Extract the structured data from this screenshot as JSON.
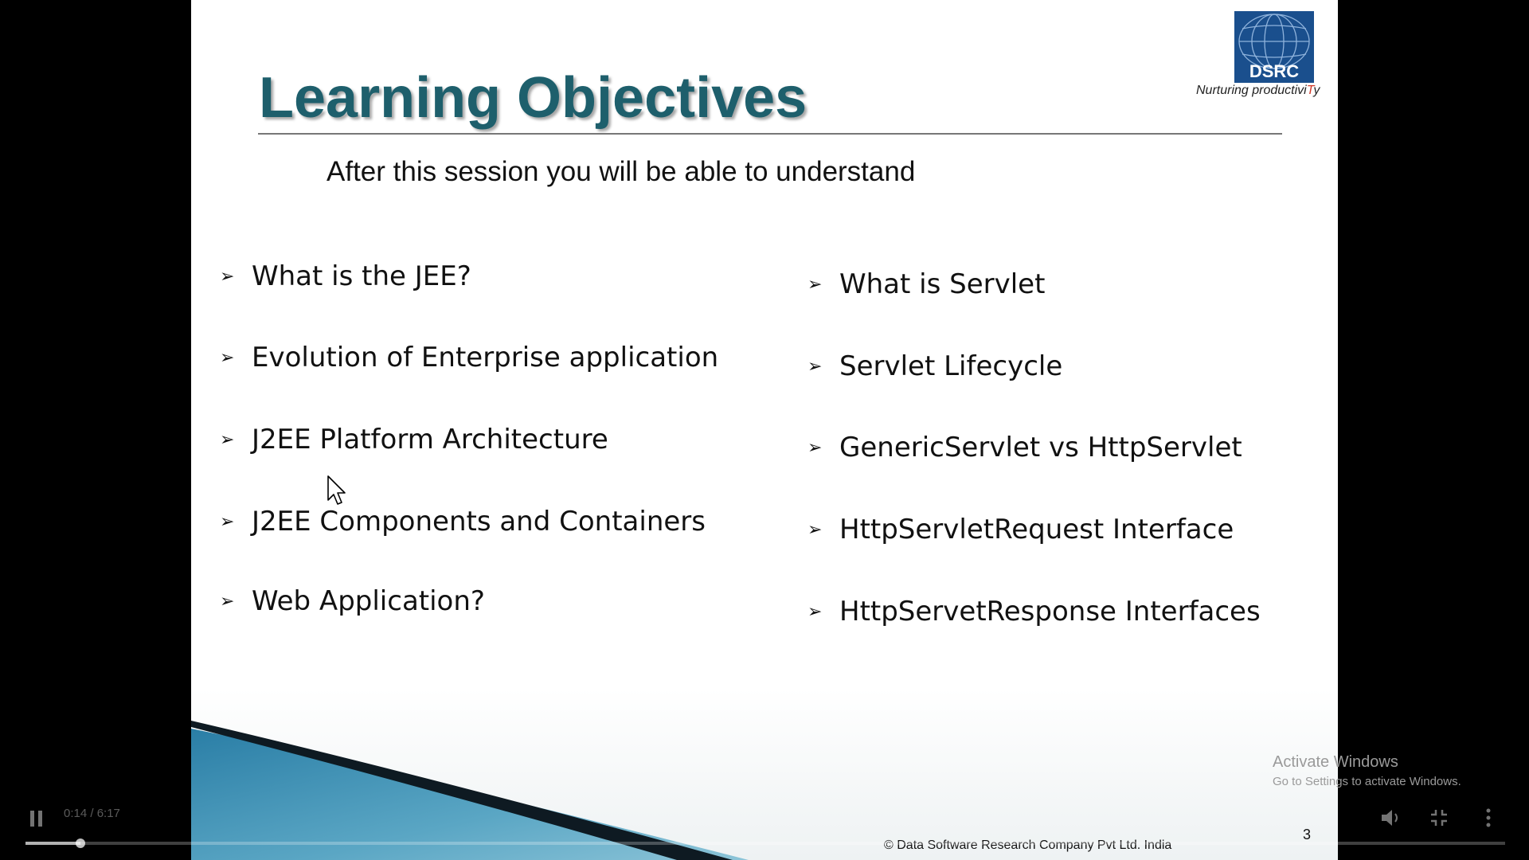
{
  "slide": {
    "title": "Learning Objectives",
    "subtitle": "After this session you will be able to understand",
    "objectives_left": [
      "What is the JEE?",
      "Evolution of Enterprise application",
      "J2EE Platform Architecture",
      "J2EE Components and Containers",
      "Web Application?"
    ],
    "objectives_right": [
      "What is Servlet",
      "Servlet Lifecycle",
      "GenericServlet vs HttpServlet",
      "HttpServletRequest Interface",
      "HttpServetResponse Interfaces"
    ],
    "bullet_glyph": "➢",
    "logo": {
      "text": "DSRC",
      "tagline_prefix": "Nurturing productivi",
      "tagline_highlight": "T",
      "tagline_suffix": "y"
    },
    "footer": "© Data Software Research Company Pvt Ltd. India",
    "page_number": "3"
  },
  "watermark": {
    "title": "Activate Windows",
    "subtitle": "Go to Settings to activate Windows."
  },
  "player": {
    "time": "0:14 / 6:17",
    "progress": 0.037,
    "icons": [
      "pause-icon",
      "volume-icon",
      "fullscreen-exit-icon",
      "more-icon"
    ]
  },
  "colors": {
    "title": "#1e5f6c",
    "background": "#000000",
    "logo_blue": "#1a4f8d",
    "wave_teal": "#3f8fb0"
  }
}
